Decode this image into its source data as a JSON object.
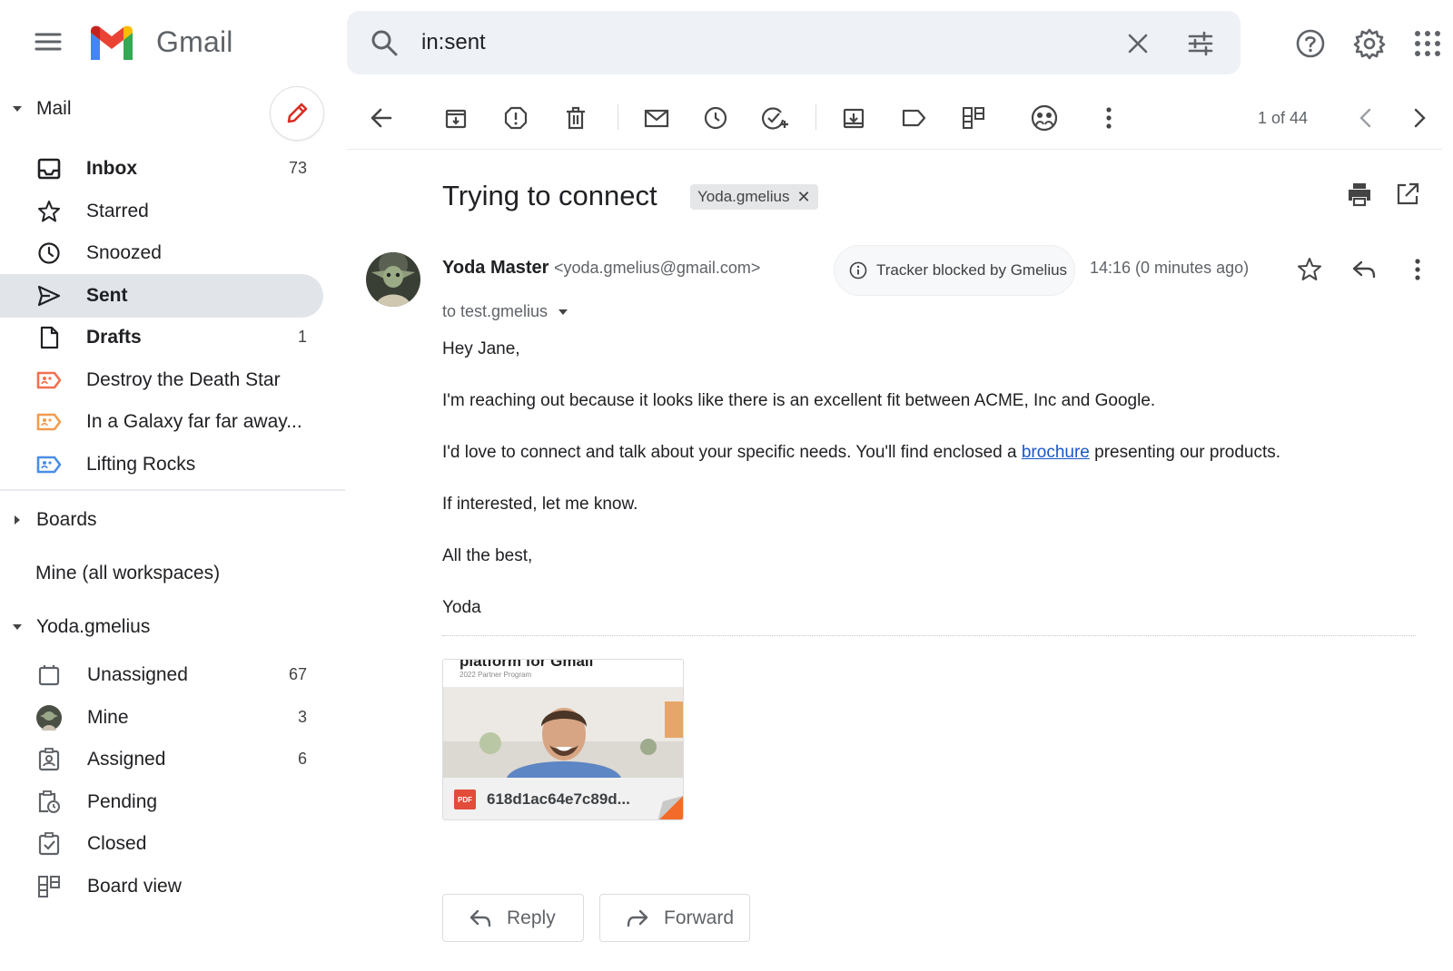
{
  "app": {
    "brand": "Gmail"
  },
  "search": {
    "query": "in:sent"
  },
  "sidebar": {
    "mail_label": "Mail",
    "items": [
      {
        "label": "Inbox",
        "count": "73",
        "bold": true,
        "icon": "inbox-icon"
      },
      {
        "label": "Starred",
        "count": "",
        "icon": "star-icon"
      },
      {
        "label": "Snoozed",
        "count": "",
        "icon": "clock-icon"
      },
      {
        "label": "Sent",
        "count": "",
        "bold": true,
        "active": true,
        "icon": "send-icon"
      },
      {
        "label": "Drafts",
        "count": "1",
        "bold": true,
        "icon": "draft-icon"
      },
      {
        "label": "Destroy the Death Star",
        "count": "",
        "icon": "label-icon",
        "color": "#f2704f"
      },
      {
        "label": "In a Galaxy far far away...",
        "count": "",
        "icon": "label-icon",
        "color": "#f29b4f"
      },
      {
        "label": "Lifting Rocks",
        "count": "",
        "icon": "label-icon",
        "color": "#4a8ee6"
      }
    ],
    "boards_label": "Boards",
    "mine_all_label": "Mine (all workspaces)",
    "workspace_label": "Yoda.gmelius",
    "workspace_items": [
      {
        "label": "Unassigned",
        "count": "67",
        "icon": "unassigned-icon"
      },
      {
        "label": "Mine",
        "count": "3",
        "icon": "avatar-icon"
      },
      {
        "label": "Assigned",
        "count": "6",
        "icon": "assigned-icon"
      },
      {
        "label": "Pending",
        "count": "",
        "icon": "pending-icon"
      },
      {
        "label": "Closed",
        "count": "",
        "icon": "closed-icon"
      },
      {
        "label": "Board view",
        "count": "",
        "icon": "board-view-icon"
      }
    ]
  },
  "toolbar": {
    "pager": "1 of 44"
  },
  "message": {
    "subject": "Trying to connect",
    "tag": "Yoda.gmelius",
    "sender_name": "Yoda Master",
    "sender_email": "<yoda.gmelius@gmail.com>",
    "tracker": "Tracker blocked by Gmelius",
    "time": "14:16 (0 minutes ago)",
    "to": "to test.gmelius",
    "greeting": "Hey Jane,",
    "p1": "I'm reaching out because it looks like there is an excellent fit between ACME, Inc and Google.",
    "p2_before": "I'd love to connect and talk about your specific needs. You'll find enclosed a ",
    "p2_link": "brochure",
    "p2_after": " presenting our products.",
    "p3": "If interested, let me know.",
    "p4": "All the best,",
    "p5": "Yoda"
  },
  "attachment": {
    "doc_title": "platform for Gmail",
    "doc_subtitle": "2022 Partner Program",
    "type_badge": "PDF",
    "filename": "618d1ac64e7c89d..."
  },
  "actions": {
    "reply": "Reply",
    "forward": "Forward"
  },
  "colors": {
    "accent_red": "#ea4335",
    "active_bg": "#e1e5ea",
    "link": "#1a56c8"
  }
}
